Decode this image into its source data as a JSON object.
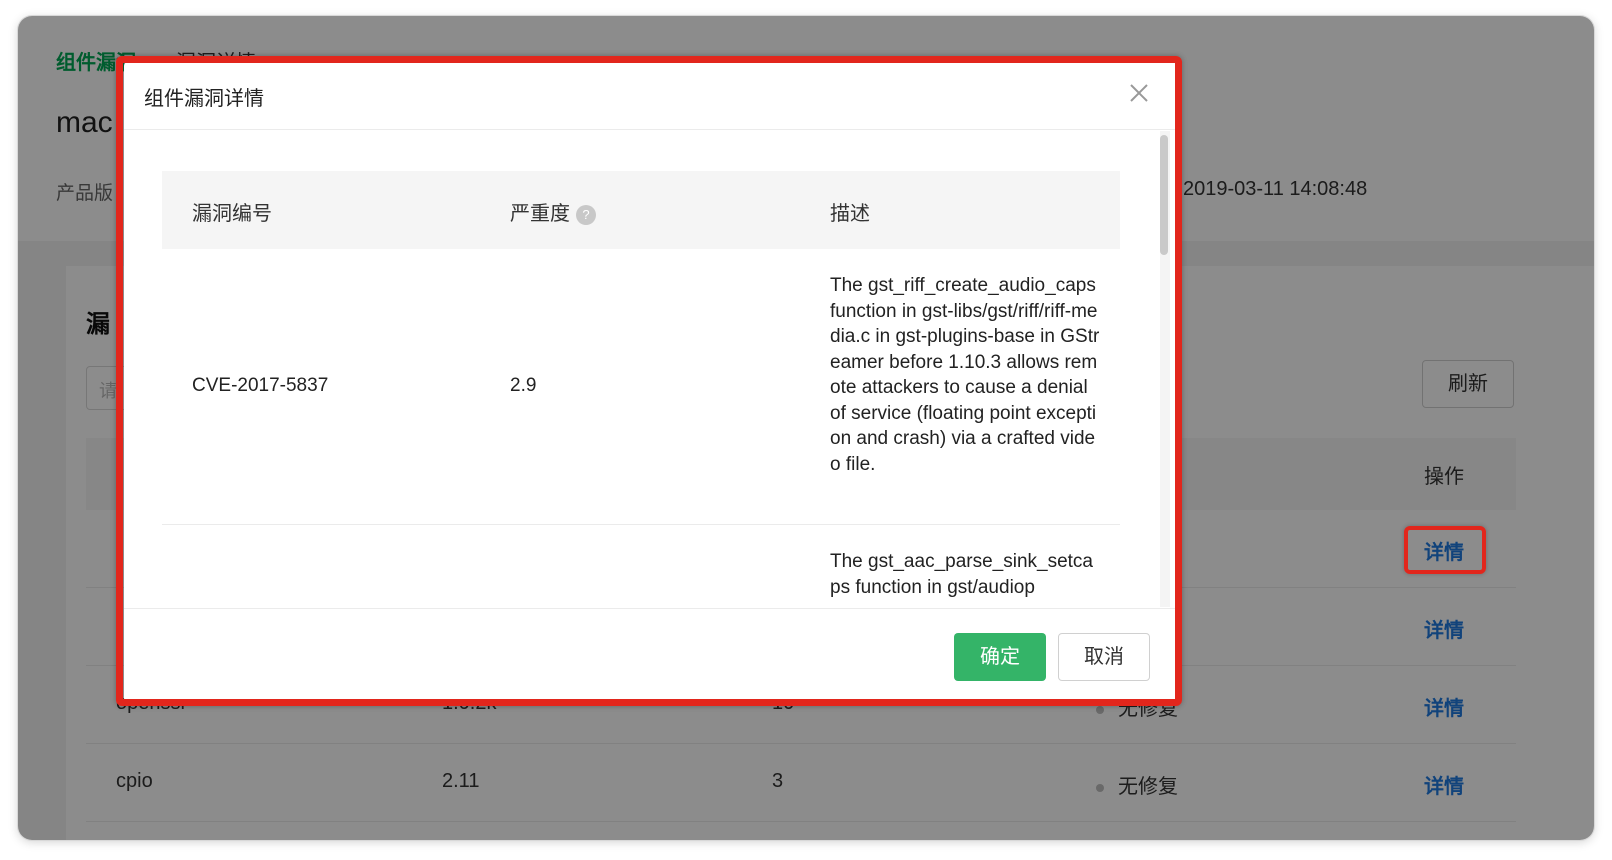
{
  "background": {
    "breadcrumb": [
      "组件漏洞",
      "漏洞详情"
    ],
    "page_title": "mac",
    "meta_left": "产品版",
    "meta_right": "2019-03-11 14:08:48",
    "section_title": "漏",
    "search_placeholder": "请",
    "refresh_label": "刷新",
    "op_header": "操作",
    "detail_label": "详情",
    "rows": [
      {
        "name": "",
        "version": "",
        "count": "",
        "status": ""
      },
      {
        "name": "",
        "version": "",
        "count": "",
        "status": ""
      },
      {
        "name": "openssl",
        "version": "1.0.2k",
        "count": "10",
        "status": "无修复"
      },
      {
        "name": "cpio",
        "version": "2.11",
        "count": "3",
        "status": "无修复"
      }
    ]
  },
  "modal": {
    "title": "组件漏洞详情",
    "columns": {
      "id": "漏洞编号",
      "severity": "严重度",
      "description": "描述"
    },
    "help_glyph": "?",
    "vulns": [
      {
        "id": "CVE-2017-5837",
        "severity": "2.9",
        "description": "The gst_riff_create_audio_caps function in gst-libs/gst/riff/riff-media.c in gst-plugins-base in GStreamer before 1.10.3 allows remote attackers to cause a denial of service (floating point exception and crash) via a crafted video file."
      },
      {
        "id": "",
        "severity": "",
        "description": "The gst_aac_parse_sink_setcaps function in gst/audiop"
      }
    ],
    "ok_label": "确定",
    "cancel_label": "取消"
  },
  "colors": {
    "accent_green": "#34b468",
    "link_blue": "#1f7ae0",
    "highlight_red": "#e2261c"
  }
}
